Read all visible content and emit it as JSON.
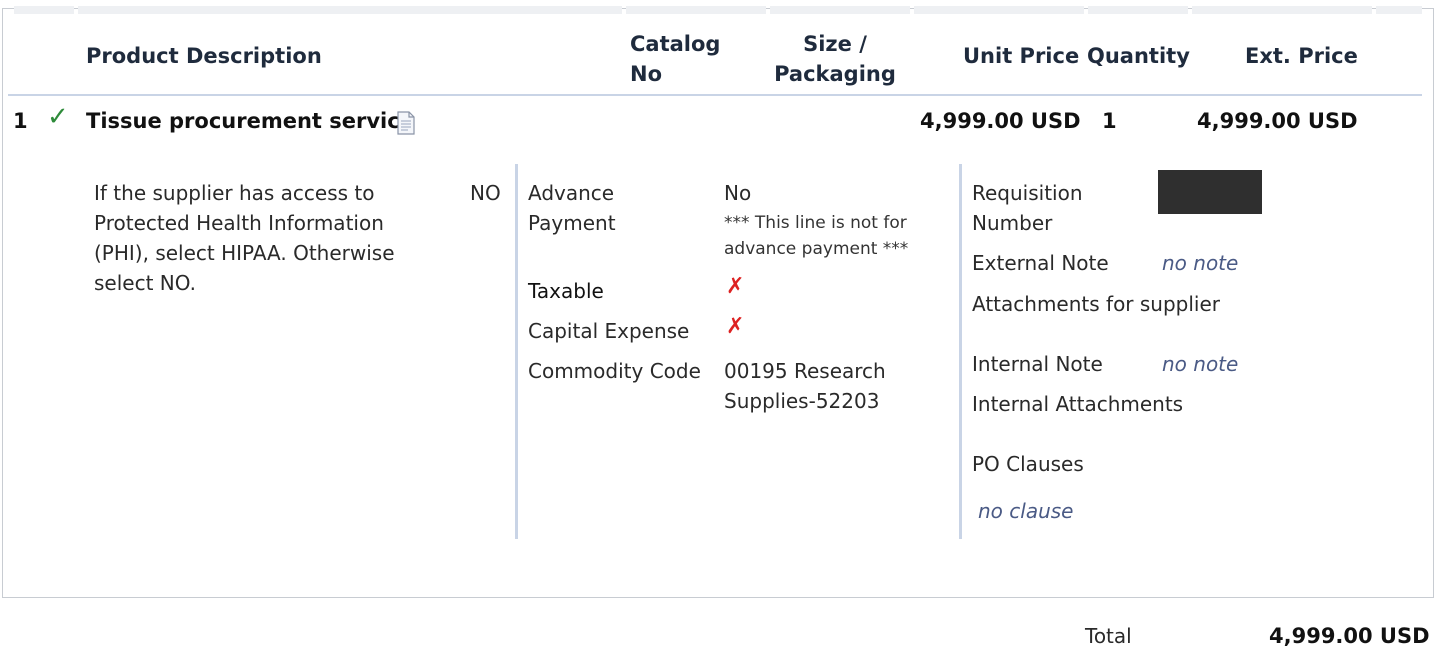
{
  "headers": {
    "product_description": "Product Description",
    "catalog_no": "Catalog No",
    "size_packaging": "Size / Packaging",
    "unit_price": "Unit Price",
    "quantity": "Quantity",
    "ext_price": "Ext. Price"
  },
  "line": {
    "number": "1",
    "check": "✓",
    "description": "Tissue procurement service",
    "unit_price": "4,999.00 USD",
    "quantity": "1",
    "ext_price": "4,999.00 USD"
  },
  "details": {
    "question": "If the supplier has access to Protected Health Information (PHI), select HIPAA. Otherwise select NO.",
    "question_answer": "NO",
    "advance_payment_label": "Advance Payment",
    "advance_payment_value": "No",
    "advance_payment_note": "*** This line is not for advance payment ***",
    "taxable_label": "Taxable",
    "capital_expense_label": "Capital Expense",
    "x_mark": "✗",
    "commodity_code_label": "Commodity Code",
    "commodity_code_value": "00195 Research Supplies-52203"
  },
  "notes": {
    "requisition_number_label": "Requisition Number",
    "external_note_label": "External Note",
    "external_note_value": "no note",
    "attachments_supplier_label": "Attachments for supplier",
    "internal_note_label": "Internal Note",
    "internal_note_value": "no note",
    "internal_attachments_label": "Internal Attachments",
    "po_clauses_label": "PO Clauses",
    "po_clauses_value": "no clause"
  },
  "total": {
    "label": "Total",
    "value": "4,999.00 USD"
  },
  "colors": {
    "check": "#2e8b3a",
    "x_mark": "#dd2222",
    "note_text": "#4a5a85",
    "separator": "#c9d4e6"
  }
}
